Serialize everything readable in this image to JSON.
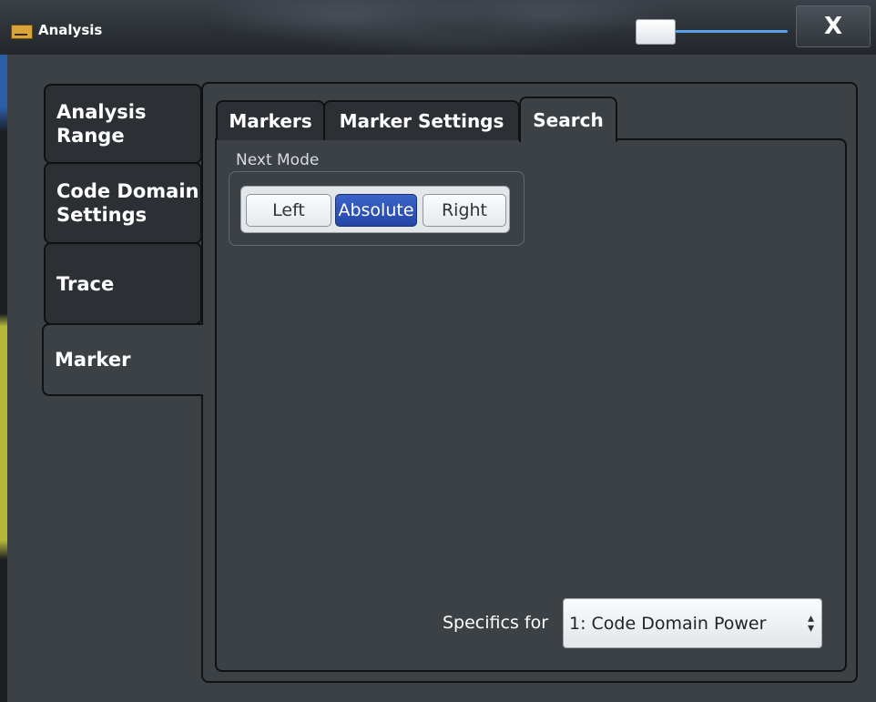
{
  "window": {
    "title": "Analysis",
    "close_label": "X"
  },
  "side_tabs": [
    {
      "label": "Analysis\nRange"
    },
    {
      "label": "Code Domain\nSettings"
    },
    {
      "label": "Trace"
    },
    {
      "label": "Marker",
      "active": true
    }
  ],
  "tabs": [
    {
      "label": "Markers"
    },
    {
      "label": "Marker Settings"
    },
    {
      "label": "Search",
      "active": true
    }
  ],
  "next_mode": {
    "label": "Next Mode",
    "options": [
      "Left",
      "Absolute",
      "Right"
    ],
    "selected": "Absolute"
  },
  "specifics": {
    "label": "Specifics for",
    "value": "1: Code Domain Power"
  },
  "colors": {
    "accent": "#2a4fb8",
    "panel": "#3c4146",
    "tab_inactive": "#2c3034"
  }
}
